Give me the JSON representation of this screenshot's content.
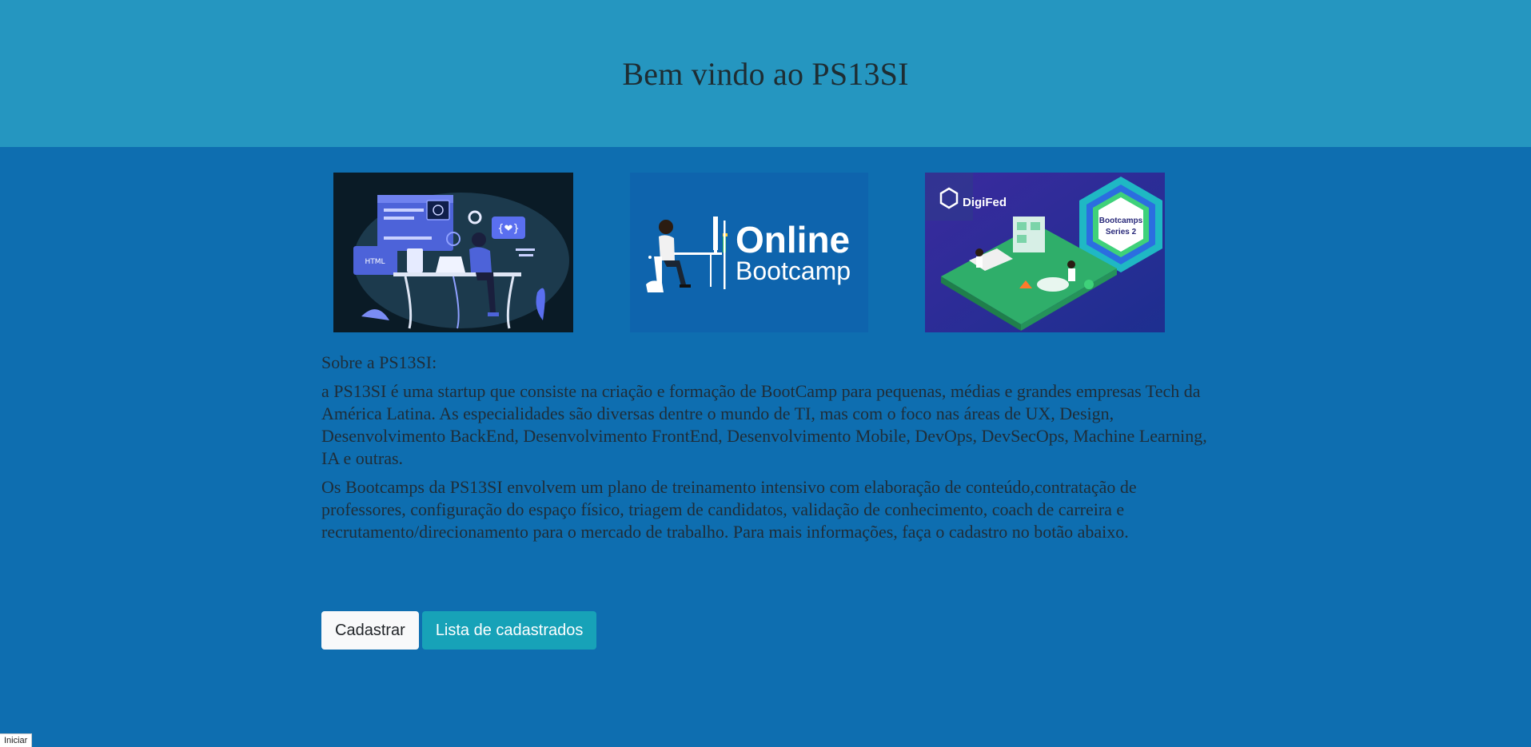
{
  "header": {
    "title": "Bem vindo ao PS13SI"
  },
  "images": [
    {
      "name": "coding-illustration",
      "labels": [
        "HTML",
        "</>"
      ]
    },
    {
      "name": "online-bootcamp-banner",
      "line1": "Online",
      "line2": "Bootcamp"
    },
    {
      "name": "digifed-bootcamps-banner",
      "brand": "DigiFed",
      "badge_line1": "Bootcamps",
      "badge_line2": "Series 2"
    }
  ],
  "about": {
    "heading": "Sobre a PS13SI:",
    "paragraph1": "a PS13SI é uma startup que consiste na criação e formação de BootCamp para pequenas, médias e grandes empresas Tech da América Latina. As especialidades são diversas dentre o mundo de TI, mas com o foco nas áreas de UX, Design, Desenvolvimento BackEnd, Desenvolvimento FrontEnd, Desenvolvimento Mobile, DevOps, DevSecOps, Machine Learning, IA e outras.",
    "paragraph2": "Os Bootcamps da PS13SI envolvem um plano de treinamento intensivo com elaboração de conteúdo,contratação de professores, configuração do espaço físico, triagem de candidatos, validação de conhecimento, coach de carreira e recrutamento/direcionamento para o mercado de trabalho. Para mais informações, faça o cadastro no botão abaixo."
  },
  "buttons": {
    "register": "Cadastrar",
    "list": "Lista de cadastrados"
  },
  "status": {
    "label": "Iniciar"
  },
  "colors": {
    "header_bg": "#2596c0",
    "page_bg": "#0e6eb0",
    "btn_info": "#17a2b8"
  }
}
